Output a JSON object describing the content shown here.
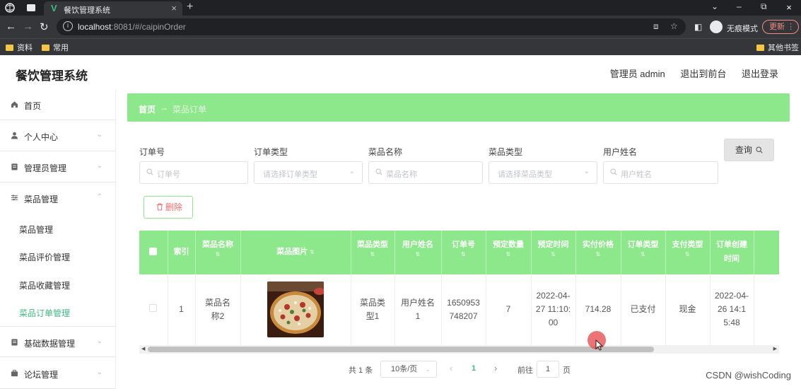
{
  "browser": {
    "tab_title": "餐饮管理系统",
    "tab_favicon": "V",
    "tab_close": "×",
    "new_tab": "+",
    "window_controls": {
      "chevron": "⌄",
      "minimize": "–",
      "restore": "⧉",
      "close": "×"
    },
    "url_host": "localhost",
    "url_rest": ":8081/#/caipinOrder",
    "profile_label": "无痕模式",
    "update_label": "更新",
    "menu_glyph": "⋮",
    "bookmarks": [
      "资料",
      "常用"
    ],
    "other_bookmarks": "其他书签"
  },
  "app": {
    "title": "餐饮管理系统",
    "user_role": "管理员 admin",
    "exit_front": "退出到前台",
    "logout": "退出登录"
  },
  "sidebar": {
    "items": [
      {
        "label": "首页",
        "icon": "home-icon"
      },
      {
        "label": "个人中心",
        "icon": "user-icon"
      },
      {
        "label": "管理员管理",
        "icon": "clipboard-icon"
      },
      {
        "label": "菜品管理",
        "icon": "sliders-icon"
      },
      {
        "label": "基础数据管理",
        "icon": "clipboard-icon"
      },
      {
        "label": "论坛管理",
        "icon": "briefcase-icon"
      }
    ],
    "sub_items": [
      "菜品管理",
      "菜品评价管理",
      "菜品收藏管理",
      "菜品订单管理"
    ],
    "active_sub_index": 3
  },
  "breadcrumb": {
    "home": "首页",
    "arrow": "→",
    "current": "菜品订单"
  },
  "filters": {
    "order_no": {
      "label": "订单号",
      "placeholder": "订单号"
    },
    "order_type": {
      "label": "订单类型",
      "placeholder": "请选择订单类型"
    },
    "dish_name": {
      "label": "菜品名称",
      "placeholder": "菜品名称"
    },
    "dish_type": {
      "label": "菜品类型",
      "placeholder": "请选择菜品类型"
    },
    "user_name": {
      "label": "用户姓名",
      "placeholder": "用户姓名"
    },
    "query_label": "查询"
  },
  "actions": {
    "delete_label": "删除"
  },
  "table": {
    "columns": [
      "索引",
      "菜品名称",
      "菜品图片",
      "菜品类型",
      "用户姓名",
      "订单号",
      "预定数量",
      "预定时间",
      "实付价格",
      "订单类型",
      "支付类型",
      "订单创建时间"
    ],
    "rows": [
      {
        "index": "1",
        "dish_name": "菜品名称2",
        "dish_type": "菜品类型1",
        "user_name": "用户姓名1",
        "order_no": "1650953748207",
        "quantity": "7",
        "book_time": "2022-04-27 11:10:00",
        "price": "714.28",
        "order_type": "已支付",
        "pay_type": "现金",
        "created_time": "2022-04-26 14:15:48"
      }
    ]
  },
  "pagination": {
    "total": "共 1 条",
    "page_size": "10条/页",
    "prev": "‹",
    "current_page": "1",
    "next": "›",
    "goto_label": "前往",
    "goto_value": "1",
    "page_suffix": "页"
  },
  "watermark": "CSDN @wishCoding",
  "colors": {
    "accent_green": "#8ce88a",
    "active_text": "#42b983",
    "delete_red": "#f56c6c"
  }
}
